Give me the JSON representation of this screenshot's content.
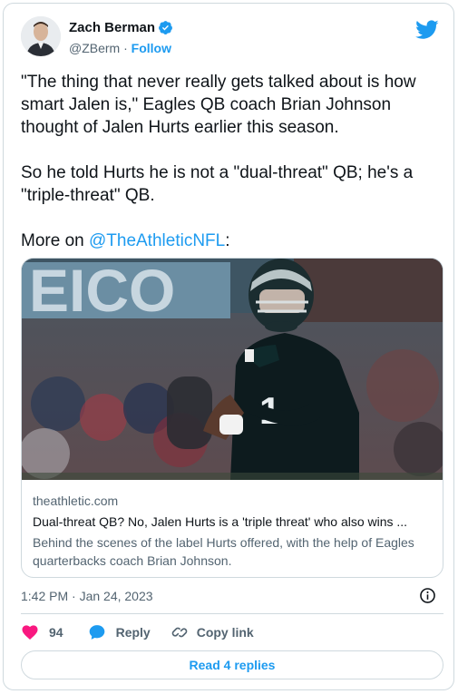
{
  "author": {
    "display_name": "Zach Berman",
    "handle": "@ZBerm",
    "separator": " · ",
    "follow_label": "Follow",
    "verified": true
  },
  "tweet": {
    "text_main": "\"The thing that never really gets talked about is how smart Jalen is,\" Eagles QB coach Brian Johnson thought of Jalen Hurts earlier this season.\n\nSo he told Hurts he is not a \"dual-threat\" QB; he's a \"triple-threat\" QB.\n\nMore on ",
    "mention": "@TheAthleticNFL",
    "text_tail": ":"
  },
  "link_card": {
    "domain": "theathletic.com",
    "title": "Dual-threat QB? No, Jalen Hurts is a 'triple threat' who also wins ...",
    "description": "Behind the scenes of the label Hurts offered, with the help of Eagles quarterbacks coach Brian Johnson.",
    "image_icon": "football-player-photo"
  },
  "meta": {
    "timestamp": "1:42 PM · Jan 24, 2023",
    "info_icon": "info-icon"
  },
  "actions": {
    "likes_count": "94",
    "reply_label": "Reply",
    "copy_link_label": "Copy link",
    "read_replies_label": "Read 4 replies"
  },
  "colors": {
    "accent": "#1d9bf0",
    "like": "#f91880",
    "text": "#0f1419",
    "secondary": "#536471",
    "border": "#cfd9de"
  }
}
